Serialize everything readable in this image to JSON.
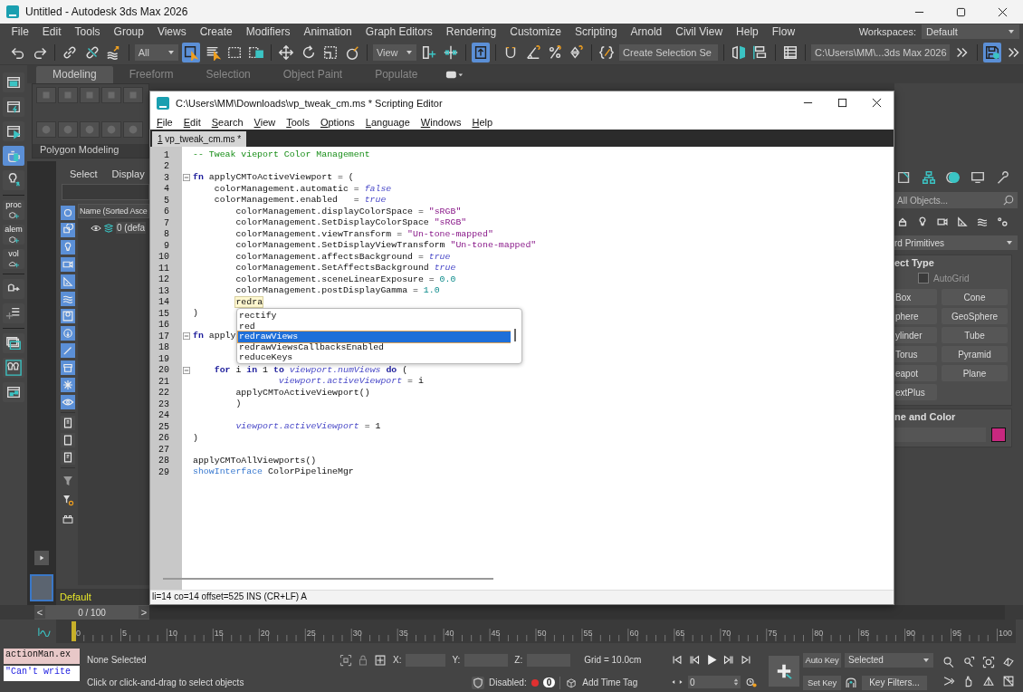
{
  "app_window": {
    "title": "Untitled - Autodesk 3ds Max 2026"
  },
  "menu_bar": [
    "File",
    "Edit",
    "Tools",
    "Group",
    "Views",
    "Create",
    "Modifiers",
    "Animation",
    "Graph Editors",
    "Rendering",
    "Customize",
    "Scripting",
    "Arnold",
    "Civil View",
    "Help",
    "Flow"
  ],
  "workspaces": {
    "label": "Workspaces:",
    "value": "Default"
  },
  "toolbar": [
    {
      "kind": "button",
      "on": false
    },
    {
      "kind": "button",
      "on": false
    },
    {
      "kind": "button",
      "on": false
    },
    {
      "kind": "button",
      "on": false
    },
    {
      "kind": "button",
      "on": false
    },
    {
      "kind": "dropdown",
      "value": "All"
    },
    {
      "kind": "button",
      "on": true
    },
    {
      "kind": "button",
      "on": false
    },
    {
      "kind": "button",
      "on": false
    },
    {
      "kind": "button",
      "on": false
    },
    {
      "kind": "button",
      "on": false
    },
    {
      "kind": "button",
      "on": false
    },
    {
      "kind": "button",
      "on": false
    },
    {
      "kind": "button",
      "on": false
    },
    {
      "kind": "dropdown",
      "value": "View"
    },
    {
      "kind": "button",
      "on": false
    },
    {
      "kind": "button",
      "on": false
    },
    {
      "kind": "button",
      "on": true
    },
    {
      "kind": "button",
      "on": false
    },
    {
      "kind": "button",
      "on": false
    },
    {
      "kind": "button",
      "on": false
    },
    {
      "kind": "button",
      "on": false
    },
    {
      "kind": "button",
      "on": false
    },
    {
      "kind": "dropdown",
      "value": "Create Selection Se"
    },
    {
      "kind": "button",
      "on": false
    },
    {
      "kind": "button",
      "on": false
    },
    {
      "kind": "button",
      "on": false
    },
    {
      "kind": "dropdown",
      "value": "C:\\Users\\MM\\...3ds Max 2026"
    },
    {
      "kind": "button",
      "on": false
    },
    {
      "kind": "button",
      "on": true
    },
    {
      "kind": "button",
      "on": false
    }
  ],
  "ribbon": {
    "tabs": [
      {
        "label": "Modeling",
        "selected": true
      },
      {
        "label": "Freeform",
        "selected": false
      },
      {
        "label": "Selection",
        "selected": false
      },
      {
        "label": "Object Paint",
        "selected": false
      },
      {
        "label": "Populate",
        "selected": false
      }
    ],
    "panel_title": "Polygon Modeling"
  },
  "left_strip": [
    {
      "kind": "icon",
      "selected": false
    },
    {
      "kind": "icon",
      "selected": false
    },
    {
      "kind": "icon",
      "selected": false
    },
    {
      "kind": "icon",
      "selected": true
    },
    {
      "kind": "icon",
      "selected": false
    },
    {
      "kind": "labeled",
      "label": "proc",
      "selected": false
    },
    {
      "kind": "labeled",
      "label": "alem",
      "selected": false
    },
    {
      "kind": "labeled",
      "label": "vol",
      "selected": false
    },
    {
      "kind": "icon",
      "selected": false
    },
    {
      "kind": "icon",
      "selected": false
    },
    {
      "kind": "icon",
      "selected": false
    },
    {
      "kind": "icon",
      "selected": false
    },
    {
      "kind": "icon",
      "selected": false
    }
  ],
  "scene_explorer": {
    "tabs": [
      "Select",
      "Display"
    ],
    "column_header": "Name (Sorted Asce",
    "rows": [
      {
        "name": "0 (defa"
      }
    ],
    "filters": [
      {
        "on": true
      },
      {
        "on": true
      },
      {
        "on": true
      },
      {
        "on": true
      },
      {
        "on": true
      },
      {
        "on": true
      },
      {
        "on": true
      },
      {
        "on": true
      },
      {
        "on": true
      },
      {
        "on": true
      },
      {
        "on": true
      },
      {
        "on": true
      },
      {
        "on": false
      },
      {
        "on": false
      },
      {
        "on": false
      }
    ],
    "layer": "Default"
  },
  "script_editor": {
    "title": "C:\\Users\\MM\\Downloads\\vp_tweak_cm.ms * Scripting Editor",
    "menu": [
      "File",
      "Edit",
      "Search",
      "View",
      "Tools",
      "Options",
      "Language",
      "Windows",
      "Help"
    ],
    "tab": "1 vp_tweak_cm.ms *",
    "lines": [
      {
        "n": "1",
        "fold": false,
        "tokens": [
          {
            "kind": "comment",
            "text": "-- Tweak vieport Color Management"
          }
        ]
      },
      {
        "n": "2",
        "fold": false
      },
      {
        "n": "3",
        "fold": true,
        "tokens": [
          {
            "kind": "keyword",
            "text": "fn"
          },
          {
            "kind": "plain",
            "text": " applyCMToActiveViewport = ("
          }
        ]
      },
      {
        "n": "4",
        "fold": false,
        "tokens": [
          {
            "kind": "plain",
            "text": "    colorManagement.automatic = "
          },
          {
            "kind": "literal",
            "text": "false"
          }
        ]
      },
      {
        "n": "5",
        "fold": false,
        "tokens": [
          {
            "kind": "plain",
            "text": "    colorManagement.enabled   = "
          },
          {
            "kind": "literal",
            "text": "true"
          }
        ]
      },
      {
        "n": "6",
        "fold": false,
        "tokens": [
          {
            "kind": "plain",
            "text": "        colorManagement.displayColorSpace = "
          },
          {
            "kind": "string",
            "text": "\"sRGB\""
          }
        ]
      },
      {
        "n": "7",
        "fold": false,
        "tokens": [
          {
            "kind": "plain",
            "text": "        colorManagement.SetDisplayColorSpace "
          },
          {
            "kind": "string",
            "text": "\"sRGB\""
          }
        ]
      },
      {
        "n": "8",
        "fold": false,
        "tokens": [
          {
            "kind": "plain",
            "text": "        colorManagement.viewTransform = "
          },
          {
            "kind": "string",
            "text": "\"Un-tone-mapped\""
          }
        ]
      },
      {
        "n": "9",
        "fold": false,
        "tokens": [
          {
            "kind": "plain",
            "text": "        colorManagement.SetDisplayViewTransform "
          },
          {
            "kind": "string",
            "text": "\"Un-tone-mapped\""
          }
        ]
      },
      {
        "n": "10",
        "fold": false,
        "tokens": [
          {
            "kind": "plain",
            "text": "        colorManagement.affectsBackground = "
          },
          {
            "kind": "literal",
            "text": "true"
          }
        ]
      },
      {
        "n": "11",
        "fold": false,
        "tokens": [
          {
            "kind": "plain",
            "text": "        colorManagement.SetAffectsBackground "
          },
          {
            "kind": "literal",
            "text": "true"
          }
        ]
      },
      {
        "n": "12",
        "fold": false,
        "tokens": [
          {
            "kind": "plain",
            "text": "        colorManagement.sceneLinearExposure = "
          },
          {
            "kind": "number",
            "text": "0.0"
          }
        ]
      },
      {
        "n": "13",
        "fold": false,
        "tokens": [
          {
            "kind": "plain",
            "text": "        colorManagement.postDisplayGamma = "
          },
          {
            "kind": "number",
            "text": "1.0"
          }
        ]
      },
      {
        "n": "14",
        "fold": false,
        "tokens": [
          {
            "kind": "typed",
            "text": "        redra"
          }
        ]
      },
      {
        "n": "15",
        "fold": false,
        "tokens": [
          {
            "kind": "plain",
            "text": ")"
          }
        ]
      },
      {
        "n": "16",
        "fold": false
      },
      {
        "n": "17",
        "fold": true,
        "tokens": [
          {
            "kind": "keyword",
            "text": "fn"
          },
          {
            "kind": "plain",
            "text": " apply"
          }
        ]
      },
      {
        "n": "18",
        "fold": false
      },
      {
        "n": "19",
        "fold": false
      },
      {
        "n": "20",
        "fold": true,
        "tokens": [
          {
            "kind": "keyword",
            "text": "    for"
          },
          {
            "kind": "plain",
            "text": " i "
          },
          {
            "kind": "keyword",
            "text": "in"
          },
          {
            "kind": "plain",
            "text": " 1 "
          },
          {
            "kind": "keyword",
            "text": "to"
          },
          {
            "kind": "literal",
            "text": " viewport.numViews "
          },
          {
            "kind": "keyword",
            "text": "do"
          },
          {
            "kind": "plain",
            "text": " ("
          }
        ]
      },
      {
        "n": "21",
        "fold": false,
        "tokens": [
          {
            "kind": "literal",
            "text": "                viewport.activeViewport"
          },
          {
            "kind": "plain",
            "text": " = i"
          }
        ]
      },
      {
        "n": "22",
        "fold": false,
        "tokens": [
          {
            "kind": "plain",
            "text": "        applyCMToActiveViewport()"
          }
        ]
      },
      {
        "n": "23",
        "fold": false,
        "tokens": [
          {
            "kind": "plain",
            "text": "        )"
          }
        ]
      },
      {
        "n": "24",
        "fold": false
      },
      {
        "n": "25",
        "fold": false,
        "tokens": [
          {
            "kind": "literal",
            "text": "        viewport.activeViewport"
          },
          {
            "kind": "plain",
            "text": " = 1"
          }
        ]
      },
      {
        "n": "26",
        "fold": false,
        "tokens": [
          {
            "kind": "plain",
            "text": ")"
          }
        ]
      },
      {
        "n": "27",
        "fold": false
      },
      {
        "n": "28",
        "fold": false,
        "tokens": [
          {
            "kind": "plain",
            "text": "applyCMToAllViewports()"
          }
        ]
      },
      {
        "n": "29",
        "fold": false,
        "tokens": [
          {
            "kind": "function",
            "text": "showInterface"
          },
          {
            "kind": "plain",
            "text": " ColorPipelineMgr"
          }
        ]
      }
    ],
    "autocomplete": [
      {
        "label": "rectify",
        "selected": false
      },
      {
        "label": "red",
        "selected": false
      },
      {
        "label": "redrawViews",
        "selected": true
      },
      {
        "label": "redrawViewsCallbacksEnabled",
        "selected": false
      },
      {
        "label": "reduceKeys",
        "selected": false
      }
    ],
    "status": "li=14 co=14 offset=525 INS (CR+LF) A"
  },
  "command_panel": {
    "search_placeholder": "All Objects...",
    "category": "rd Primitives",
    "object_type": {
      "title": "ect Type",
      "autogrid": {
        "label": "AutoGrid",
        "checked": false
      },
      "buttons": [
        "Box",
        "Cone",
        "phere",
        "GeoSphere",
        "ylinder",
        "Tube",
        "Torus",
        "Pyramid",
        "eapot",
        "Plane",
        "extPlus"
      ]
    },
    "name_color": {
      "title": "ne and Color",
      "color": "#c8287f"
    }
  },
  "timeline": {
    "prev": "<",
    "frame": "0 / 100",
    "next": ">",
    "level": 0,
    "ticks": [
      "0",
      "5",
      "10",
      "15",
      "20",
      "25",
      "30",
      "35",
      "40",
      "45",
      "50",
      "55",
      "60",
      "65",
      "70",
      "75",
      "80",
      "85",
      "90",
      "95",
      "100"
    ]
  },
  "status_bar": {
    "listener_input": "actionMan.ex",
    "listener_output": "\"Can't write",
    "selection": "None Selected",
    "prompt": "Click or click-and-drag to select objects",
    "x_label": "X:",
    "y_label": "Y:",
    "z_label": "Z:",
    "grid": "Grid = 10.0cm",
    "disabled_label": "Disabled:",
    "disabled_count": "0",
    "time_tag": "Add Time Tag",
    "frame": "0",
    "auto_key": "Auto Key",
    "set_key": "Set Key",
    "key_mode": "Selected",
    "key_filters": "Key Filters..."
  }
}
